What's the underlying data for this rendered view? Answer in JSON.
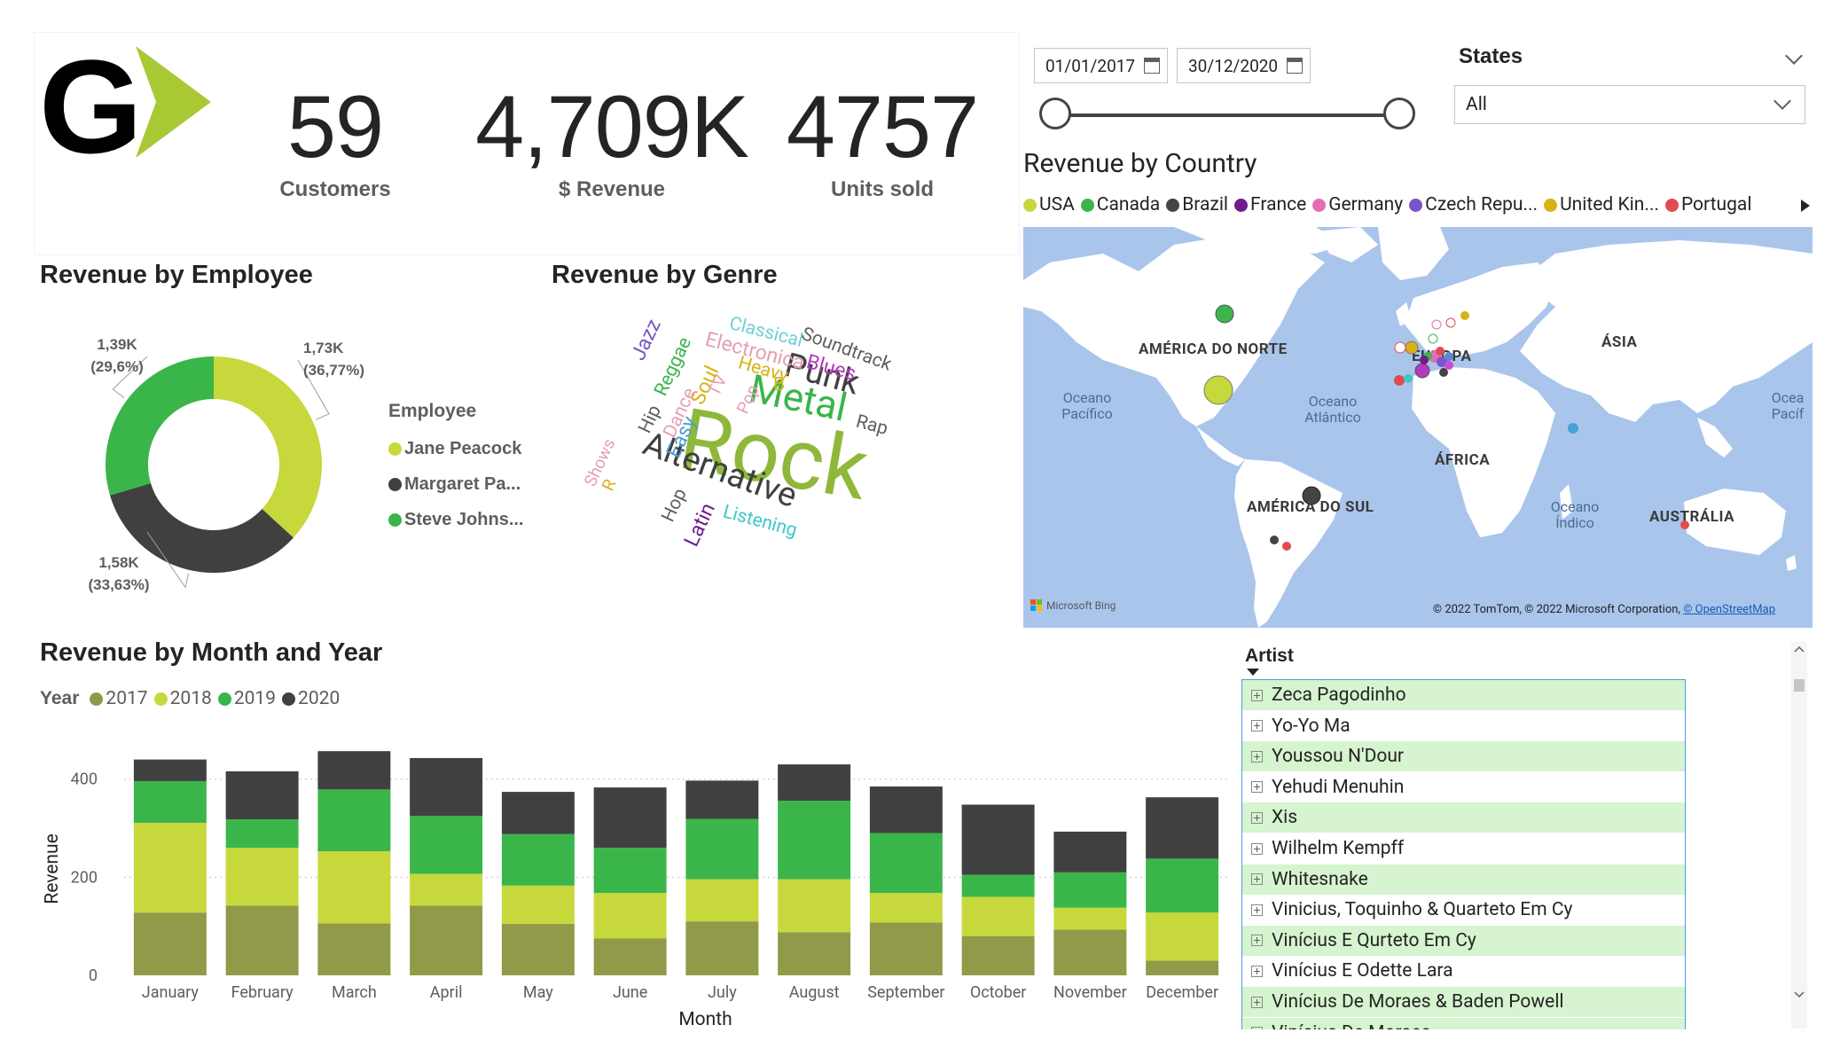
{
  "logo": {
    "letter": "G"
  },
  "kpis": [
    {
      "value": "59",
      "label": "Customers"
    },
    {
      "value": "4,709K",
      "label": "$ Revenue"
    },
    {
      "value": "4757",
      "label": "Units sold"
    }
  ],
  "date_slicer": {
    "start": "01/01/2017",
    "end": "30/12/2020",
    "range_start_fraction": 0,
    "range_end_fraction": 1
  },
  "states_slicer": {
    "title": "States",
    "value": "All"
  },
  "revenue_by_country": {
    "title": "Revenue by Country",
    "legend": [
      {
        "name": "USA",
        "color": "#c6d83c"
      },
      {
        "name": "Canada",
        "color": "#3ab54a"
      },
      {
        "name": "Brazil",
        "color": "#444444"
      },
      {
        "name": "France",
        "color": "#6e1d8c"
      },
      {
        "name": "Germany",
        "color": "#e26fb5"
      },
      {
        "name": "Czech Repu...",
        "color": "#7a55c8"
      },
      {
        "name": "United Kin...",
        "color": "#d7b216"
      },
      {
        "name": "Portugal",
        "color": "#e14b51"
      }
    ],
    "map_labels": {
      "north_america": "AMÉRICA DO NORTE",
      "europe": "EUROPA",
      "asia": "ÁSIA",
      "africa": "ÁFRICA",
      "south_america": "AMÉRICA DO SUL",
      "australia": "AUSTRÁLIA",
      "pacific_ocean": "Oceano Pacífico",
      "atlantic_ocean": "Oceano Atlântico",
      "indian_ocean": "Oceano Índico",
      "pacific_ocean_east": "Ocea Pacíf"
    },
    "attribution": "© 2022 TomTom, © 2022 Microsoft Corporation,",
    "attribution_link": "© OpenStreetMap",
    "bing": "Microsoft Bing"
  },
  "revenue_by_employee": {
    "title": "Revenue by Employee",
    "legend_title": "Employee",
    "chart_data": {
      "type": "pie",
      "slices": [
        {
          "name": "Jane Peacock",
          "label": "Jane Peacock",
          "value": 1.73,
          "value_label": "1,73K",
          "percent_label": "(36,77%)",
          "color": "#c6d83c"
        },
        {
          "name": "Margaret Park",
          "label": "Margaret Pa...",
          "value": 1.58,
          "value_label": "1,58K",
          "percent_label": "(33,63%)",
          "color": "#404040"
        },
        {
          "name": "Steve Johnson",
          "label": "Steve Johns...",
          "value": 1.39,
          "value_label": "1,39K",
          "percent_label": "(29,6%)",
          "color": "#3ab54a"
        }
      ]
    }
  },
  "revenue_by_genre": {
    "title": "Revenue by Genre",
    "words": [
      "Rock",
      "Metal",
      "Alternative",
      "Punk",
      "Classical",
      "Soundtrack",
      "Electronica",
      "Blues",
      "Heavy",
      "Jazz",
      "Reggae",
      "Soul",
      "TV",
      "Pop",
      "B",
      "Rap",
      "Hip",
      "Dance",
      "Easy",
      "Hop",
      "Latin",
      "Listening",
      "Shows",
      "R"
    ]
  },
  "revenue_by_month": {
    "title": "Revenue by Month and Year",
    "legend_title": "Year",
    "chart_data": {
      "type": "bar",
      "stacked": true,
      "categories": [
        "January",
        "February",
        "March",
        "April",
        "May",
        "June",
        "July",
        "August",
        "September",
        "October",
        "November",
        "December"
      ],
      "series": [
        {
          "name": "2017",
          "color": "#909a48",
          "values": [
            128,
            142,
            106,
            142,
            105,
            75,
            110,
            88,
            108,
            80,
            93,
            30
          ]
        },
        {
          "name": "2018",
          "color": "#c6d83c",
          "values": [
            183,
            118,
            147,
            65,
            78,
            93,
            86,
            108,
            60,
            80,
            45,
            98
          ]
        },
        {
          "name": "2019",
          "color": "#3ab54a",
          "values": [
            85,
            58,
            126,
            118,
            105,
            92,
            123,
            160,
            122,
            45,
            72,
            110
          ]
        },
        {
          "name": "2020",
          "color": "#404040",
          "values": [
            44,
            98,
            78,
            118,
            86,
            123,
            78,
            74,
            95,
            143,
            83,
            125
          ]
        }
      ],
      "xlabel": "Month",
      "ylabel": "Revenue",
      "yticks": [
        0,
        200,
        400
      ],
      "ylim": [
        0,
        470
      ],
      "grid": true,
      "legend_position": "top-left"
    }
  },
  "artist_table": {
    "header": "Artist",
    "rows": [
      "Zeca Pagodinho",
      "Yo-Yo Ma",
      "Youssou N'Dour",
      "Yehudi Menuhin",
      "Xis",
      "Wilhelm Kempff",
      "Whitesnake",
      "Vinicius, Toquinho & Quarteto Em Cy",
      "Vinícius E Qurteto Em Cy",
      "Vinícius E Odette Lara",
      "Vinícius De Moraes & Baden Powell"
    ],
    "partial_row": "Vinícius De Moraes"
  }
}
